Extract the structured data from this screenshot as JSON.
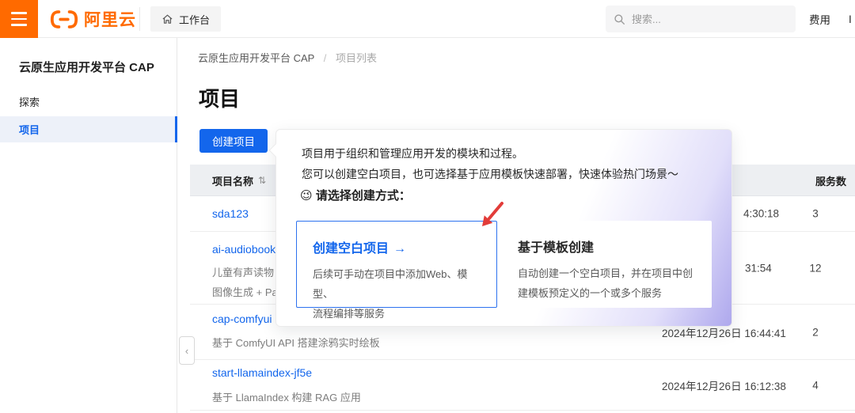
{
  "topbar": {
    "logo_text": "阿里云",
    "workbench_label": "工作台",
    "search_placeholder": "搜索...",
    "billing_label": "费用",
    "partial_item": "I"
  },
  "sidebar": {
    "title": "云原生应用开发平台 CAP",
    "items": [
      {
        "label": "探索",
        "active": false
      },
      {
        "label": "项目",
        "active": true
      }
    ]
  },
  "breadcrumb": {
    "root": "云原生应用开发平台 CAP",
    "separator": "/",
    "current": "项目列表"
  },
  "page": {
    "title": "项目",
    "create_button": "创建项目"
  },
  "popup": {
    "intro_line1": "项目用于组织和管理应用开发的模块和过程。",
    "intro_line2": "您可以创建空白项目，也可选择基于应用模板快速部署，快速体验热门场景～",
    "prompt_emoji": "😉",
    "prompt_text": "请选择创建方式：",
    "cards": [
      {
        "title": "创建空白项目",
        "arrow": "→",
        "desc_line1": "后续可手动在项目中添加Web、模型、",
        "desc_line2": "流程编排等服务"
      },
      {
        "title": "基于模板创建",
        "desc_line1": "自动创建一个空白项目，并在项目中创",
        "desc_line2": "建模板预定义的一个或多个服务"
      }
    ]
  },
  "table": {
    "headers": {
      "name": "项目名称",
      "sort_icon": "⇅",
      "services": "服务数"
    },
    "rows": [
      {
        "name": "sda123",
        "time": "4:30:18",
        "services": "3"
      },
      {
        "name": "ai-audiobook",
        "desc_line1": "儿童有声读物",
        "desc_line2": "图像生成 + Pa",
        "time": "31:54",
        "services": "12"
      },
      {
        "name": "cap-comfyui",
        "desc_line1": "基于 ComfyUI API 搭建涂鸦实时绘板",
        "time": "2024年12月26日 16:44:41",
        "services": "2"
      },
      {
        "name": "start-llamaindex-jf5e",
        "desc_line1": "基于 LlamaIndex 构建 RAG 应用",
        "time": "2024年12月26日 16:12:38",
        "services": "4"
      }
    ]
  },
  "icons": {
    "hamburger": "hamburger-menu-icon",
    "home": "home-icon",
    "search": "search-icon",
    "collapse": "‹"
  },
  "colors": {
    "brand_orange": "#ff6a00",
    "primary_blue": "#1366ec",
    "popup_gradient": "#aea8ed",
    "annotation_red": "#e23c39"
  }
}
